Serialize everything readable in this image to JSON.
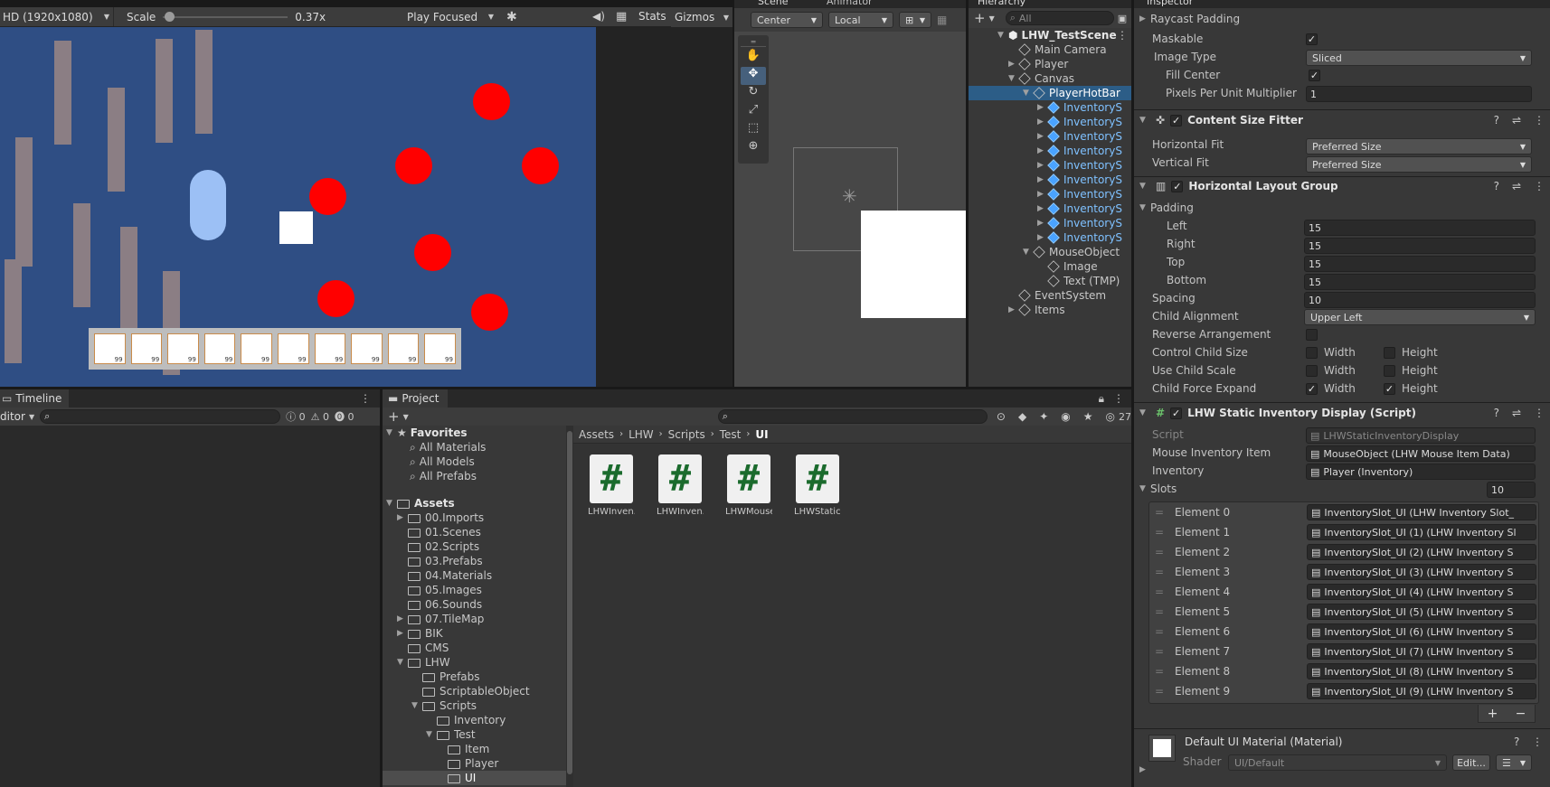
{
  "game": {
    "resolution": "HD (1920x1080)",
    "scale_label": "Scale",
    "scale_value": "0.37x",
    "play_mode": "Play Focused",
    "stats": "Stats",
    "gizmos": "Gizmos",
    "hotbar_count": "99",
    "colors": {
      "background": "#2f4e84",
      "pillar": "#8b7e84",
      "enemy": "#ff0000",
      "player": "#9cc0f5"
    }
  },
  "scene": {
    "tabs": [
      "Scene",
      "Animator"
    ],
    "pivot": "Center",
    "space": "Local"
  },
  "hierarchy": {
    "tab": "Hierarchy",
    "search_placeholder": "All",
    "scene_name": "LHW_TestScene",
    "items": [
      {
        "label": "Main Camera"
      },
      {
        "label": "Player"
      },
      {
        "label": "Canvas"
      },
      {
        "label": "PlayerHotBar"
      },
      {
        "label": "InventoryS"
      },
      {
        "label": "InventoryS"
      },
      {
        "label": "InventoryS"
      },
      {
        "label": "InventoryS"
      },
      {
        "label": "InventoryS"
      },
      {
        "label": "InventoryS"
      },
      {
        "label": "InventoryS"
      },
      {
        "label": "InventoryS"
      },
      {
        "label": "InventoryS"
      },
      {
        "label": "InventoryS"
      },
      {
        "label": "MouseObject"
      },
      {
        "label": "Image"
      },
      {
        "label": "Text (TMP)"
      },
      {
        "label": "EventSystem"
      },
      {
        "label": "Items"
      }
    ]
  },
  "inspector": {
    "tab": "Inspector",
    "raycast_padding": "Raycast Padding",
    "maskable": "Maskable",
    "image_type_label": "Image Type",
    "image_type_value": "Sliced",
    "fill_center": "Fill Center",
    "ppu_label": "Pixels Per Unit Multiplier",
    "ppu_value": "1",
    "csf_title": "Content Size Fitter",
    "h_fit_label": "Horizontal Fit",
    "h_fit_value": "Preferred Size",
    "v_fit_label": "Vertical Fit",
    "v_fit_value": "Preferred Size",
    "hlg_title": "Horizontal Layout Group",
    "padding": "Padding",
    "left": "Left",
    "left_value": "15",
    "right": "Right",
    "right_value": "15",
    "top": "Top",
    "top_value": "15",
    "bottom": "Bottom",
    "bottom_value": "15",
    "spacing": "Spacing",
    "spacing_value": "10",
    "child_alignment": "Child Alignment",
    "child_alignment_value": "Upper Left",
    "reverse": "Reverse Arrangement",
    "ccs": "Control Child Size",
    "ucs": "Use Child Scale",
    "cfe": "Child Force Expand",
    "width": "Width",
    "height": "Height",
    "script_title": "LHW Static Inventory Display (Script)",
    "script_label": "Script",
    "script_value": "LHWStaticInventoryDisplay",
    "mouse_label": "Mouse Inventory Item",
    "mouse_value": "MouseObject (LHW Mouse Item Data)",
    "inv_label": "Inventory",
    "inv_value": "Player (Inventory)",
    "slots_label": "Slots",
    "slots_count": "10",
    "elements": [
      {
        "label": "Element 0",
        "value": "InventorySlot_UI (LHW Inventory Slot_"
      },
      {
        "label": "Element 1",
        "value": "InventorySlot_UI (1) (LHW Inventory Sl"
      },
      {
        "label": "Element 2",
        "value": "InventorySlot_UI (2) (LHW Inventory S"
      },
      {
        "label": "Element 3",
        "value": "InventorySlot_UI (3) (LHW Inventory S"
      },
      {
        "label": "Element 4",
        "value": "InventorySlot_UI (4) (LHW Inventory S"
      },
      {
        "label": "Element 5",
        "value": "InventorySlot_UI (5) (LHW Inventory S"
      },
      {
        "label": "Element 6",
        "value": "InventorySlot_UI (6) (LHW Inventory S"
      },
      {
        "label": "Element 7",
        "value": "InventorySlot_UI (7) (LHW Inventory S"
      },
      {
        "label": "Element 8",
        "value": "InventorySlot_UI (8) (LHW Inventory S"
      },
      {
        "label": "Element 9",
        "value": "InventorySlot_UI (9) (LHW Inventory S"
      }
    ],
    "material_title": "Default UI Material (Material)",
    "shader_label": "Shader",
    "shader_value": "UI/Default",
    "edit_button": "Edit..."
  },
  "timeline": {
    "tab": "Timeline",
    "mode": "ditor",
    "counts": [
      "0",
      "0",
      "0"
    ]
  },
  "project": {
    "tab": "Project",
    "count": "27",
    "favorites": "Favorites",
    "fav_items": [
      "All Materials",
      "All Models",
      "All Prefabs"
    ],
    "assets": "Assets",
    "asset_folders": [
      "00.Imports",
      "01.Scenes",
      "02.Scripts",
      "03.Prefabs",
      "04.Materials",
      "05.Images",
      "06.Sounds",
      "07.TileMap",
      "BIK",
      "CMS",
      "LHW"
    ],
    "lhw_children": [
      "Prefabs",
      "ScriptableObject",
      "Scripts"
    ],
    "scripts_children": [
      "Inventory",
      "Test"
    ],
    "test_children": [
      "Item",
      "Player",
      "UI"
    ],
    "breadcrumb": [
      "Assets",
      "LHW",
      "Scripts",
      "Test",
      "UI"
    ],
    "files": [
      "LHWInven...",
      "LHWInven...",
      "LHWMouse...",
      "LHWStatic..."
    ]
  }
}
